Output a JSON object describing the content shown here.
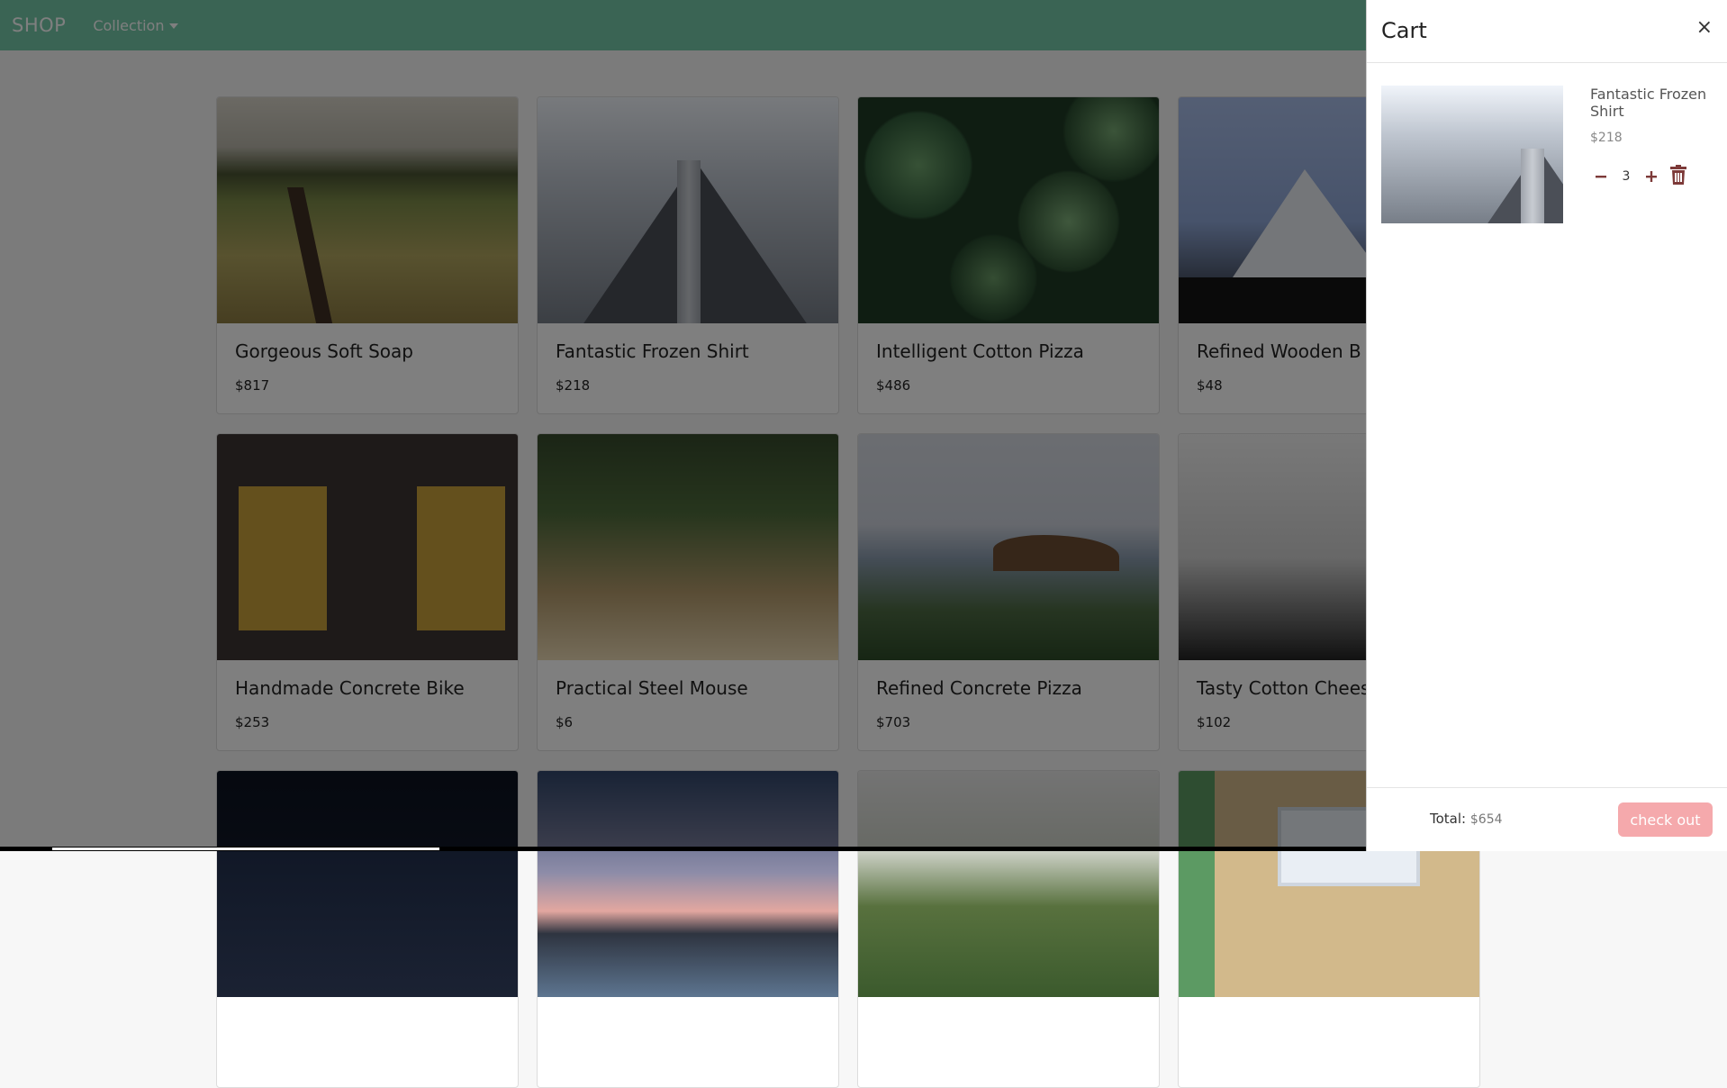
{
  "navbar": {
    "brand": "SHOP",
    "collection_label": "Collection"
  },
  "products": [
    {
      "title": "Gorgeous Soft Soap",
      "price": "$817",
      "image": "meadow"
    },
    {
      "title": "Fantastic Frozen Shirt",
      "price": "$218",
      "image": "tower"
    },
    {
      "title": "Intelligent Cotton Pizza",
      "price": "$486",
      "image": "succulent"
    },
    {
      "title": "Refined Wooden B",
      "price": "$48",
      "image": "mountain"
    },
    {
      "title": "Handmade Concrete Bike",
      "price": "$253",
      "image": "shutters"
    },
    {
      "title": "Practical Steel Mouse",
      "price": "$6",
      "image": "grass"
    },
    {
      "title": "Refined Concrete Pizza",
      "price": "$703",
      "image": "coast"
    },
    {
      "title": "Tasty Cotton Chees",
      "price": "$102",
      "image": "fog"
    }
  ],
  "cart": {
    "title": "Cart",
    "close_icon": "×",
    "items": [
      {
        "name": "Fantastic Frozen Shirt",
        "price": "$218",
        "quantity": "3",
        "image": "tower"
      }
    ],
    "total_label": "Total:",
    "total_value": "$654",
    "checkout_label": "check out"
  },
  "colors": {
    "navbar": "#74c8a9",
    "checkout": "#f5a9ac",
    "qty_icons": "#7d3a39"
  }
}
